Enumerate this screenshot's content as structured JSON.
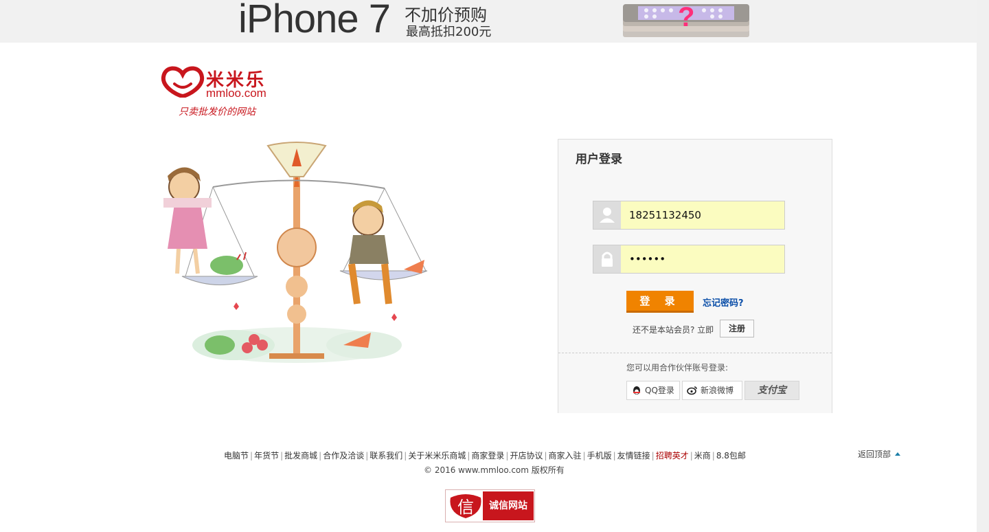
{
  "banner": {
    "model": "iPhone 7",
    "promo_line1": "不加价预购",
    "promo_line2": "最高抵扣200元"
  },
  "logo": {
    "brand": "米米乐",
    "domain": "mmloo.com",
    "slogan": "只卖批发价的网站"
  },
  "login": {
    "title": "用户登录",
    "username_value": "18251132450",
    "password_value": "••••••",
    "login_button": "登 录",
    "forgot_link": "忘记密码?",
    "not_member_text": "还不是本站会员? 立即",
    "register_button": "注册",
    "partner_text": "您可以用合作伙伴账号登录:",
    "qq_button": "QQ登录",
    "weibo_button": "新浪微博",
    "alipay_button": "支付宝"
  },
  "footer": {
    "links": [
      "电脑节",
      "年货节",
      "批发商城",
      "合作及洽谈",
      "联系我们",
      "关于米米乐商城",
      "商家登录",
      "开店协议",
      "商家入驻",
      "手机版",
      "友情链接",
      "招聘英才",
      "米商",
      "8.8包邮"
    ],
    "copyright": "© 2016 www.mmloo.com 版权所有",
    "back_to_top": "返回顶部",
    "trust_badge": "诚信网站",
    "trust_badge_icon_text": "信"
  },
  "colors": {
    "brand_red": "#c8161d",
    "login_orange": "#f08300",
    "input_yellow": "#fbfcc0",
    "link_blue": "#0a4ea8"
  }
}
